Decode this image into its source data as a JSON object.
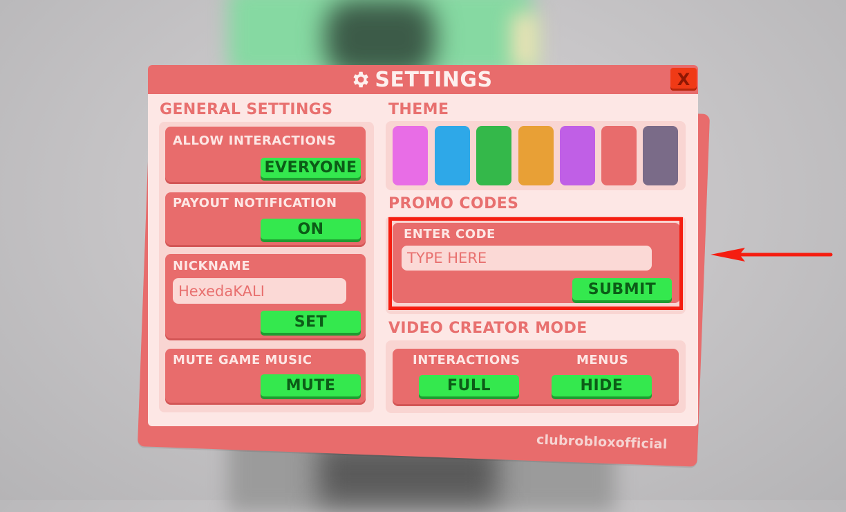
{
  "header": {
    "title": "SETTINGS",
    "close_label": "X"
  },
  "general": {
    "title": "GENERAL SETTINGS",
    "allow_interactions": {
      "label": "ALLOW INTERACTIONS",
      "button": "EVERYONE"
    },
    "payout_notification": {
      "label": "PAYOUT NOTIFICATION",
      "button": "ON"
    },
    "nickname": {
      "label": "NICKNAME",
      "value": "HexedaKALI",
      "button": "SET"
    },
    "mute_music": {
      "label": "MUTE GAME MUSIC",
      "button": "MUTE"
    }
  },
  "theme": {
    "title": "THEME",
    "colors": [
      "#e86de6",
      "#2ea8e8",
      "#34b84a",
      "#e8a036",
      "#c05fe6",
      "#e86c6c",
      "#7a6b88"
    ]
  },
  "promo": {
    "title": "PROMO CODES",
    "label": "ENTER CODE",
    "placeholder": "TYPE HERE",
    "submit": "SUBMIT"
  },
  "video_creator": {
    "title": "VIDEO CREATOR MODE",
    "interactions_label": "INTERACTIONS",
    "interactions_button": "FULL",
    "menus_label": "MENUS",
    "menus_button": "HIDE"
  },
  "watermark": "clubrobloxofficial",
  "colors": {
    "panel_red": "#e86c6c",
    "panel_bg": "#fde7e5",
    "button_green": "#34e84e",
    "highlight_red": "#f51d10"
  }
}
